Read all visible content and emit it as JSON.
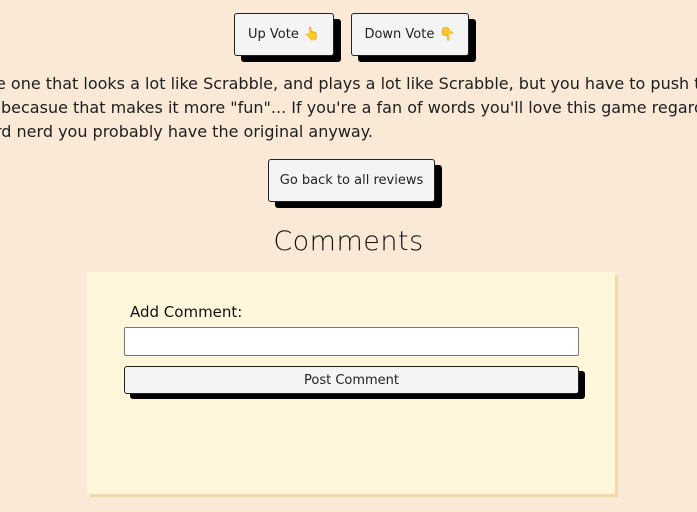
{
  "votes": {
    "up_label": "Up Vote",
    "up_icon": "👆",
    "down_label": "Down Vote",
    "down_icon": "👇"
  },
  "review": {
    "lines": [
      "e one that looks a lot like Scrabble, and plays a lot like Scrabble, but you have to push the let",
      "becasue that makes it more \"fun\"... If you're a fan of words you'll love this game regardless, l",
      "rd nerd you probably have the original anyway."
    ]
  },
  "navigation": {
    "back_label": "Go back to all reviews"
  },
  "comments": {
    "title": "Comments",
    "add_label": "Add Comment:",
    "input_value": "",
    "input_placeholder": "",
    "post_label": "Post Comment"
  }
}
